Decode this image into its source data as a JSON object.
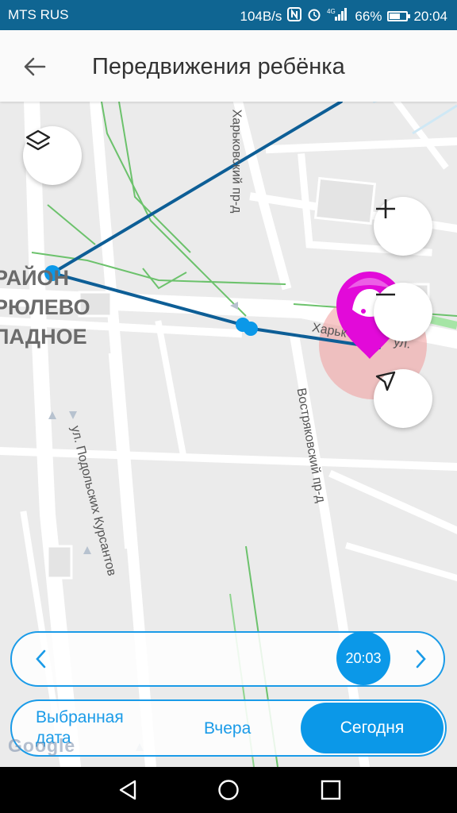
{
  "status_bar": {
    "carrier": "MTS RUS",
    "net_speed": "104B/s",
    "network_type": "4G",
    "battery": "66%",
    "battery_level": 0.66,
    "time": "20:04",
    "icons": [
      "nfc-icon",
      "alarm-icon",
      "signal-icon",
      "battery-icon"
    ]
  },
  "appbar": {
    "title": "Передвижения ребёнка",
    "back_icon": "arrow-left-icon"
  },
  "map": {
    "labels": {
      "district_line1": "РАЙОН",
      "district_line2": "РЮЛЕВО",
      "district_line3": "ПАДНОЕ",
      "street_kharkovsky": "Харьковский пр-д",
      "street_kharkovsky_ul": "Харьк",
      "street_ul_suffix": "ул.",
      "street_vostryakovsky": "Востряковский пр-д",
      "street_podolskikh": "ул. Подольских Курсантов"
    },
    "controls": {
      "layers_icon": "layers-icon",
      "zoom_in_icon": "plus-icon",
      "zoom_out_icon": "minus-icon",
      "locate_icon": "navigation-arrow-icon"
    },
    "colors": {
      "track": "#0d5e96",
      "point": "#0b98e8",
      "marker": "#e20ad9",
      "accuracy_circle": "#f19a9a"
    },
    "attribution": "Google"
  },
  "timeline": {
    "current_time": "20:03",
    "prev_icon": "chevron-left-icon",
    "next_icon": "chevron-right-icon"
  },
  "date_selector": {
    "option_selected_date": "Выбранная дата",
    "option_yesterday": "Вчера",
    "option_today": "Сегодня",
    "active": "Сегодня"
  },
  "navbar": {
    "back_icon": "triangle-back-icon",
    "home_icon": "circle-home-icon",
    "recents_icon": "square-recents-icon"
  }
}
